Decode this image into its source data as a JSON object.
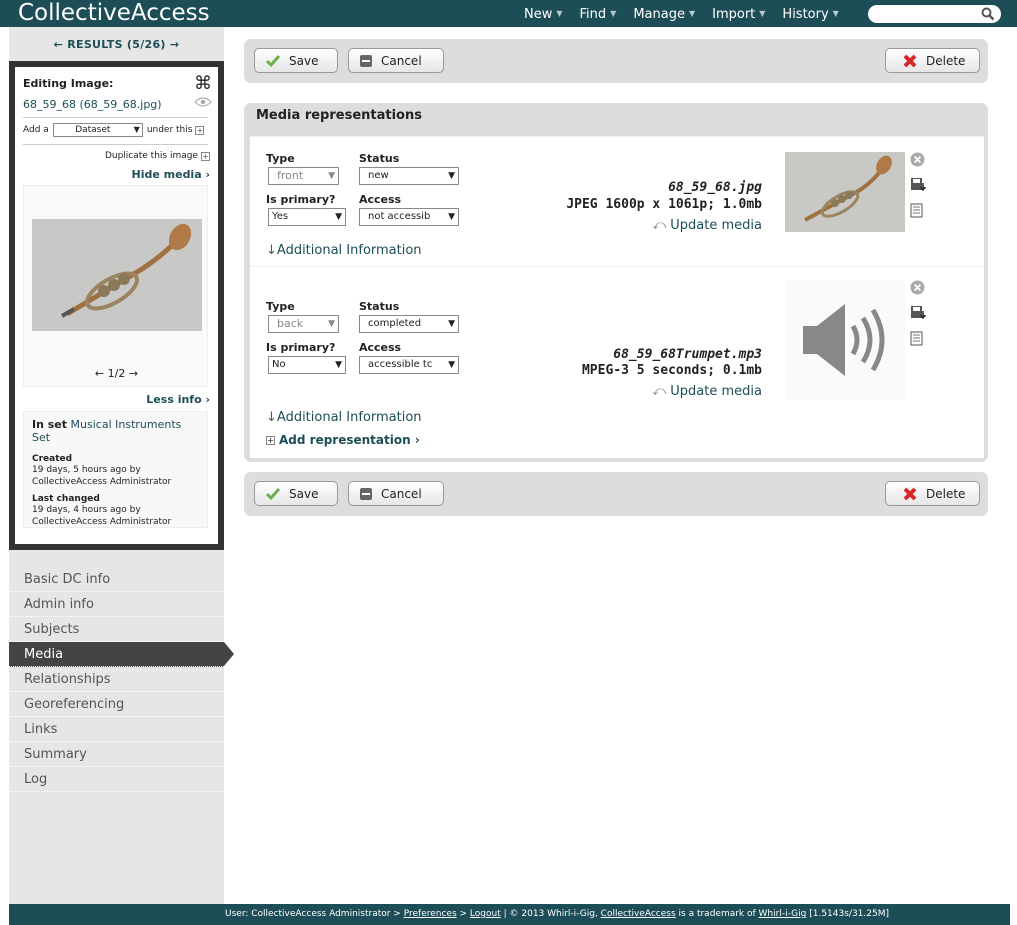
{
  "app": {
    "title": "CollectiveAccess"
  },
  "nav": [
    "New",
    "Find",
    "Manage",
    "Import",
    "History"
  ],
  "search": {
    "placeholder": ""
  },
  "results": {
    "label": "← RESULTS (5/26) →"
  },
  "inspector": {
    "title": "Editing Image:",
    "file": "68_59_68 (68_59_68.jpg)",
    "add_prefix": "Add a",
    "add_select": "Dataset",
    "add_suffix": "under this",
    "duplicate": "Duplicate this image",
    "hide_media": "Hide media ›",
    "pager": "← 1/2 →",
    "less_info": "Less info ›",
    "in_set_label": "In set",
    "in_set_name": "Musical Instruments Set",
    "created_label": "Created",
    "created_value": "19 days, 5 hours ago by CollectiveAccess Administrator",
    "changed_label": "Last changed",
    "changed_value": "19 days, 4 hours ago by CollectiveAccess Administrator"
  },
  "sidenav": [
    "Basic DC info",
    "Admin info",
    "Subjects",
    "Media",
    "Relationships",
    "Georeferencing",
    "Links",
    "Summary",
    "Log"
  ],
  "sidenav_active": "Media",
  "buttons": {
    "save": "Save",
    "cancel": "Cancel",
    "delete": "Delete"
  },
  "media": {
    "title": "Media representations",
    "labels": {
      "type": "Type",
      "status": "Status",
      "primary": "Is primary?",
      "access": "Access"
    },
    "reps": [
      {
        "type": "front",
        "status": "new",
        "primary": "Yes",
        "access": "not accessib",
        "filename": "68_59_68.jpg",
        "info": "JPEG 1600p x 1061p; 1.0mb",
        "update": "Update media",
        "additional": "Additional Information"
      },
      {
        "type": "back",
        "status": "completed",
        "primary": "No",
        "access": "accessible tc",
        "filename": "68_59_68Trumpet.mp3",
        "info": "MPEG-3 5 seconds; 0.1mb",
        "update": "Update media",
        "additional": "Additional Information"
      }
    ],
    "add_rep": "Add representation ›"
  },
  "footer": {
    "user": "User: CollectiveAccess Administrator > ",
    "prefs": "Preferences",
    "sep": " > ",
    "logout": "Logout",
    "copy": " | © 2013 Whirl-i-Gig, ",
    "ca": "CollectiveAccess",
    "tm": " is a trademark of ",
    "wig": "Whirl-i-Gig",
    "stats": " [1.5143s/31.25M]"
  },
  "colors": {
    "brand": "#1d4e57",
    "delete": "#d9262a"
  }
}
